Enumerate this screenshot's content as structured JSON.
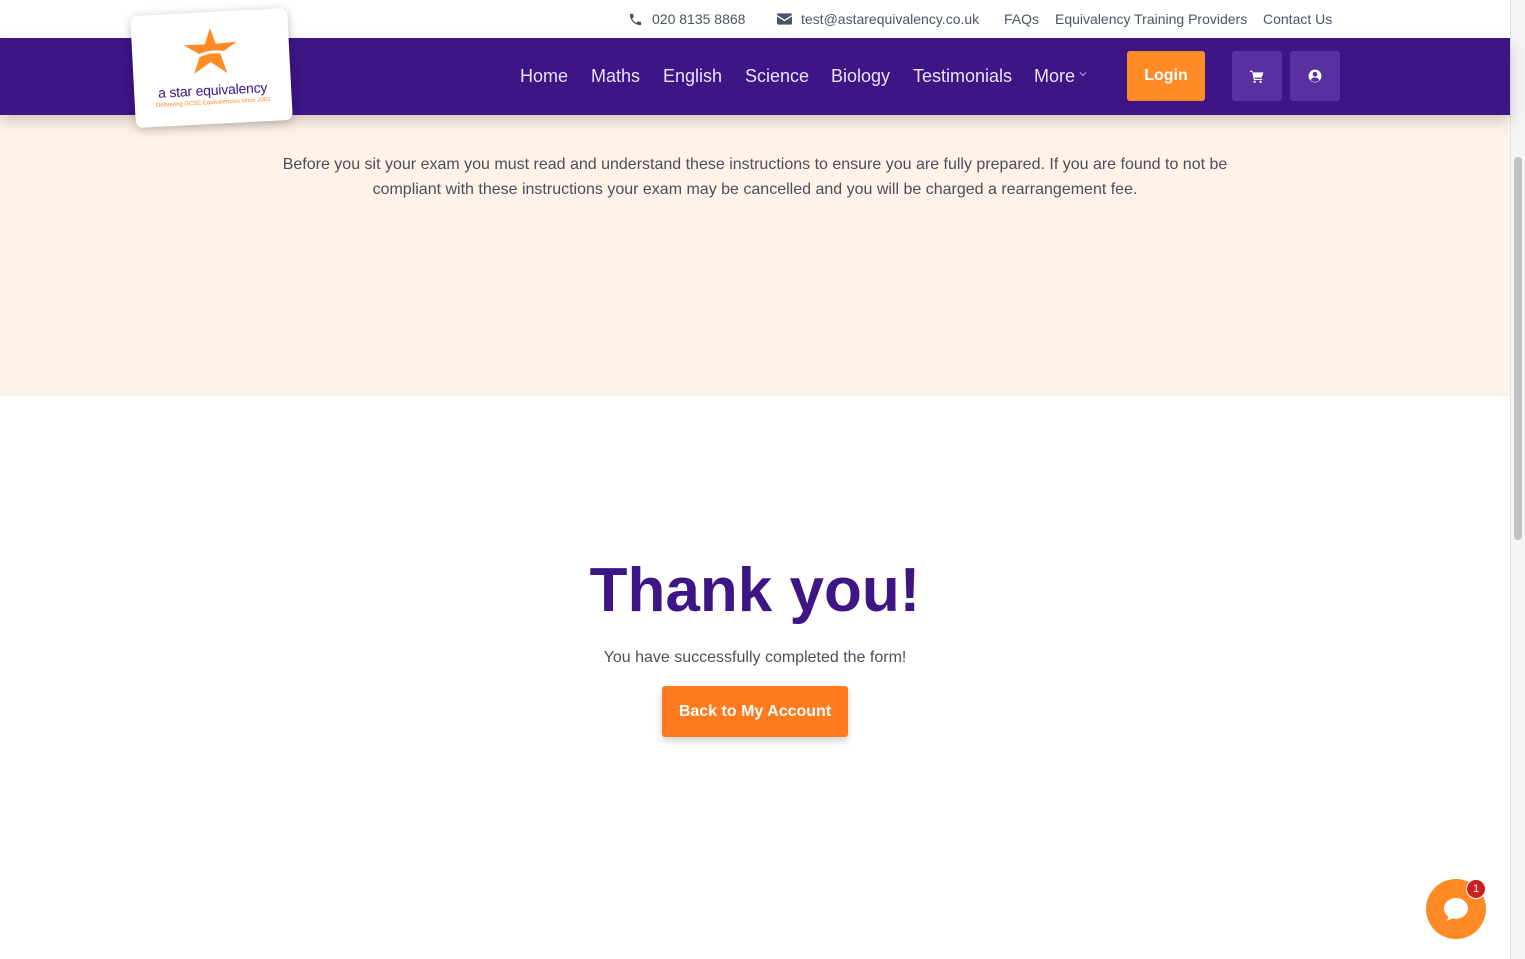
{
  "topbar": {
    "phone": "020 8135 8868",
    "email": "test@astarequivalency.co.uk",
    "links": [
      "FAQs",
      "Equivalency Training Providers",
      "Contact Us"
    ]
  },
  "logo": {
    "name": "a star equivalency",
    "tagline": "Delivering GCSE Equivalencies since 2002"
  },
  "nav": {
    "items": [
      "Home",
      "Maths",
      "English",
      "Science",
      "Biology",
      "Testimonials",
      "More"
    ],
    "login_label": "Login"
  },
  "intro": {
    "text": "Before you sit your exam you must read and understand these instructions to ensure you are fully prepared. If you are found to not be compliant with these instructions your exam may be cancelled and you will be charged a rearrangement fee."
  },
  "confirmation": {
    "title": "Thank you!",
    "message": "You have successfully completed the form!",
    "button_label": "Back to My Account"
  },
  "chat": {
    "badge_count": "1"
  },
  "colors": {
    "brand_purple": "#3d1585",
    "accent_orange": "#ff8a26",
    "intro_bg": "#fff2e8"
  }
}
